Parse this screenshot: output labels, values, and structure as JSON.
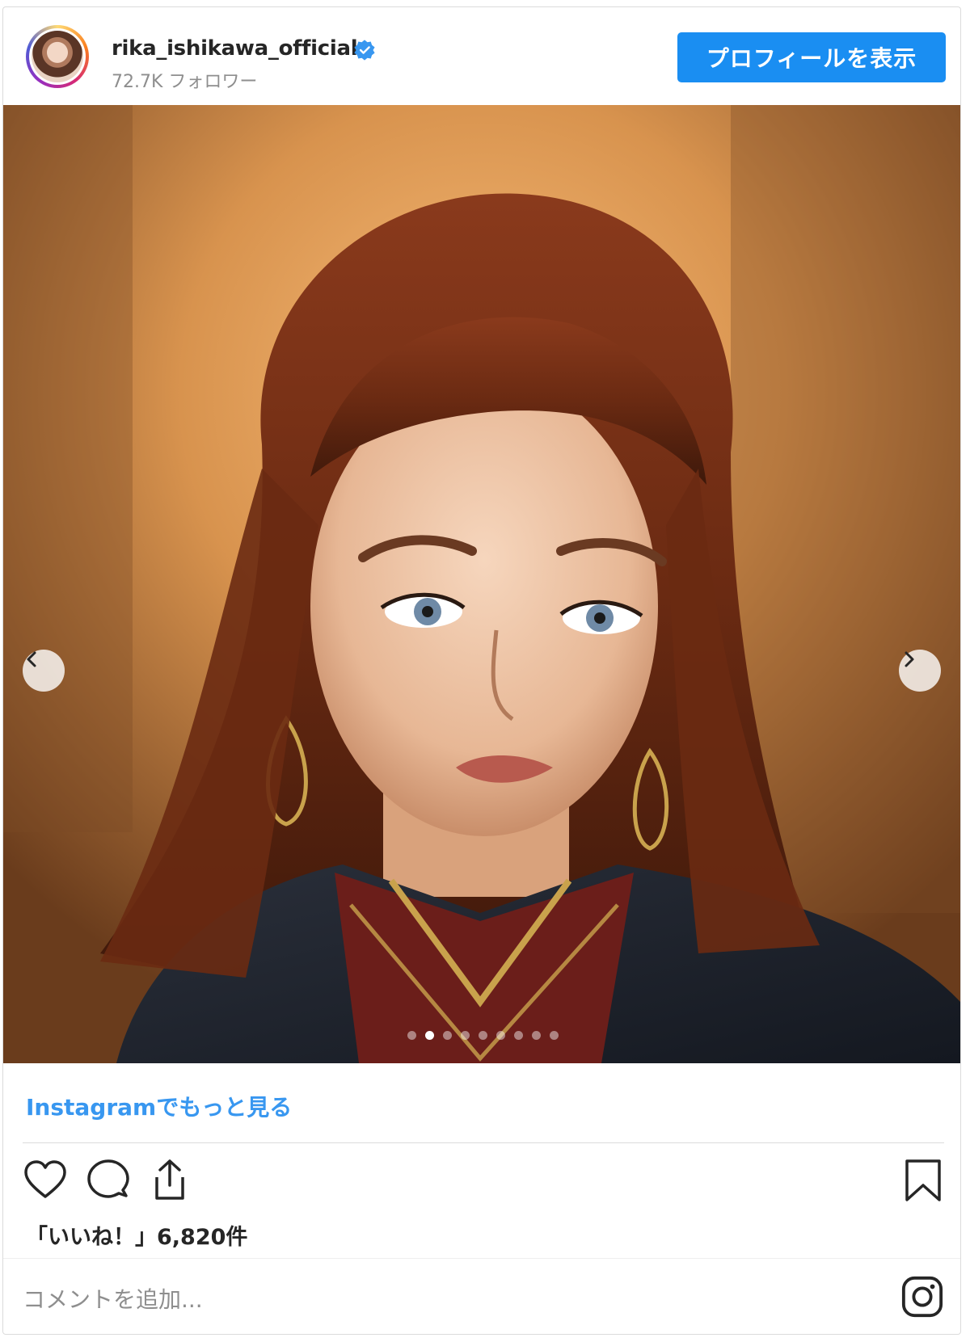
{
  "post": {
    "username": "rika_ishikawa_official",
    "followers": "72.7K フォロワー",
    "profile_button": "プロフィールを表示",
    "more_link": "Instagramでもっと見る",
    "likes": "「いいね！」6,820件",
    "comment_placeholder": "コメントを追加...",
    "carousel": {
      "total": 9,
      "active_index": 1
    }
  },
  "colors": {
    "accent": "#1a8ef2",
    "link": "#3897f0",
    "verified": "#3897f0"
  },
  "icons": [
    "verified-badge-icon",
    "chevron-left-icon",
    "chevron-right-icon",
    "heart-icon",
    "comment-icon",
    "share-icon",
    "bookmark-icon",
    "instagram-icon"
  ]
}
